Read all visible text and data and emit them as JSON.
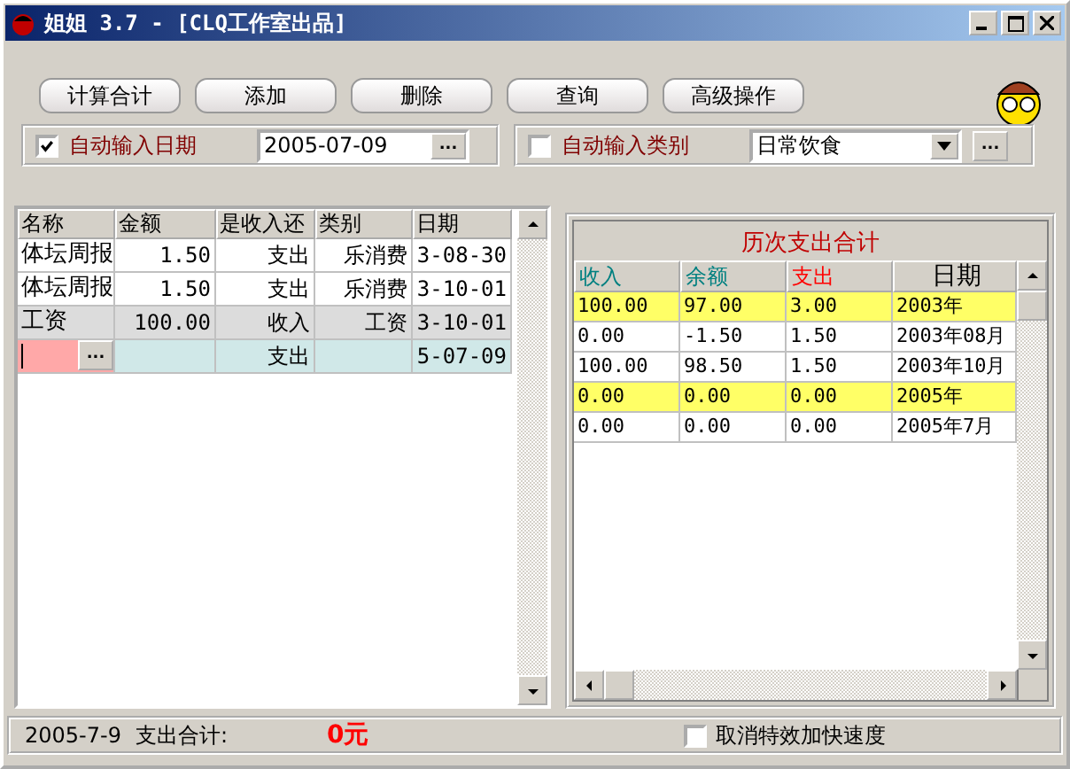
{
  "window": {
    "title": "姐姐 3.7 - [CLQ工作室出品]"
  },
  "toolbar": {
    "buttons": [
      "计算合计",
      "添加",
      "删除",
      "查询",
      "高级操作"
    ]
  },
  "date_option": {
    "label": "自动输入日期",
    "checked": true,
    "value": "2005-07-09",
    "button": "..."
  },
  "category_option": {
    "label": "自动输入类别",
    "checked": false,
    "value": "日常饮食",
    "button": "..."
  },
  "records": {
    "columns": [
      "名称",
      "金额",
      "是收入还",
      "类别",
      "日期"
    ],
    "rows": [
      {
        "kind": "entry",
        "name": "体坛周报",
        "amount": "1.50",
        "type": "支出",
        "category": "乐消费",
        "date": "3-08-30"
      },
      {
        "kind": "entry",
        "name": "体坛周报",
        "amount": "1.50",
        "type": "支出",
        "category": "乐消费",
        "date": "3-10-01"
      },
      {
        "kind": "current",
        "name": "工资",
        "amount": "100.00",
        "type": "收入",
        "category": "工资",
        "date": "3-10-01"
      },
      {
        "kind": "new",
        "button": "...",
        "type": "支出",
        "date": "5-07-09"
      }
    ]
  },
  "summary": {
    "title": "历次支出合计",
    "columns": [
      {
        "label": "收入",
        "color": "#008080"
      },
      {
        "label": "余额",
        "color": "#008080"
      },
      {
        "label": "支出",
        "color": "#ff0000"
      },
      {
        "label": "日期",
        "color": "#000000"
      }
    ],
    "rows": [
      {
        "highlighted": true,
        "cells": [
          "100.00",
          "97.00",
          "3.00",
          "2003年"
        ]
      },
      {
        "highlighted": false,
        "cells": [
          "0.00",
          "-1.50",
          "1.50",
          "2003年08月"
        ]
      },
      {
        "highlighted": false,
        "cells": [
          "100.00",
          "98.50",
          "1.50",
          "2003年10月"
        ]
      },
      {
        "highlighted": true,
        "cells": [
          "0.00",
          "0.00",
          "0.00",
          "2005年"
        ]
      },
      {
        "highlighted": false,
        "cells": [
          "0.00",
          "0.00",
          "0.00",
          "2005年7月"
        ]
      }
    ]
  },
  "status_bar": {
    "date": "2005-7-9",
    "label": "支出合计:",
    "total": "0元",
    "speed_option": {
      "label": "取消特效加快速度",
      "checked": false
    }
  }
}
